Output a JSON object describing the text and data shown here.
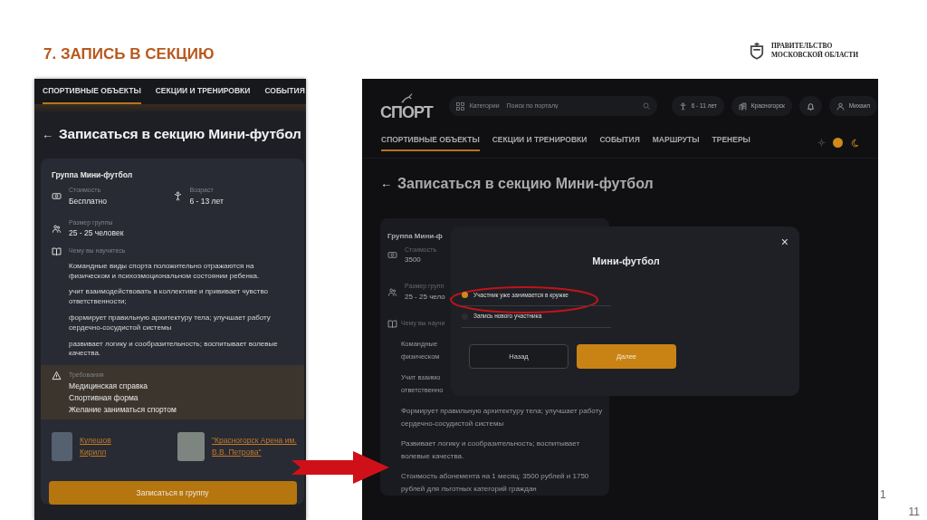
{
  "slide": {
    "title": "7. ЗАПИСЬ В СЕКЦИЮ",
    "logo_lines": [
      "ПРАВИТЕЛЬСТВО",
      "МОСКОВСКОЙ ОБЛАСТИ"
    ],
    "page_number_fragment": "1",
    "page_number": "11"
  },
  "mobile_screen": {
    "nav": [
      {
        "label": "СПОРТИВНЫЕ ОБЪЕКТЫ",
        "selected": true
      },
      {
        "label": "СЕКЦИИ И ТРЕНИРОВКИ",
        "selected": false
      },
      {
        "label": "СОБЫТИЯ",
        "selected": false
      }
    ],
    "back": "←",
    "heading": "Записаться в секцию Мини-футбол",
    "group_title": "Группа Мини-футбол",
    "info": [
      {
        "kind": "cost",
        "label": "Стоимость",
        "value": "Бесплатно"
      },
      {
        "kind": "age",
        "label": "Возраст",
        "value": "6 - 13 лет"
      },
      {
        "kind": "group",
        "label": "Размер группы",
        "value": "25 - 25 человек"
      }
    ],
    "learn_label": "Чему вы научитесь",
    "paragraphs": [
      "Командные виды спорта положительно отражаются на физическом и психоэмоциональном состоянии ребенка.",
      "учит взаимодействовать в коллективе и прививает чувство ответственности;",
      "формирует правильную архитектуру тела; улучшает работу сердечно-сосудистой системы",
      "развивает логику и сообразительность; воспитывает волевые качества."
    ],
    "requirements": {
      "label": "Требования",
      "items": [
        "Медицинская справка",
        "Спортивная форма",
        "Желание заниматься спортом"
      ]
    },
    "coach": "Кулешов Кирилл",
    "venue": "\"Красногорск Арена им. В.В. Петрова\"",
    "button": "Записаться в группу"
  },
  "desktop_screen": {
    "logo": "СПОРТ",
    "categories": "Категории",
    "search": {
      "placeholder": "Поиск по порталу"
    },
    "age_chip": "6 - 11 лет",
    "city_chip": "Красногорск",
    "user": "Михаил",
    "nav": [
      {
        "label": "СПОРТИВНЫЕ ОБЪЕКТЫ",
        "selected": true
      },
      {
        "label": "СЕКЦИИ И ТРЕНИРОВКИ",
        "selected": false
      },
      {
        "label": "СОБЫТИЯ",
        "selected": false
      },
      {
        "label": "МАРШРУТЫ",
        "selected": false
      },
      {
        "label": "ТРЕНЕРЫ",
        "selected": false
      }
    ],
    "dark_theme": true,
    "back": "←",
    "heading": "Записаться в секцию Мини-футбол",
    "card": {
      "group_title": "Группа Мини-ф",
      "info": [
        {
          "kind": "cost",
          "label": "Стоимость",
          "value": "3500"
        },
        {
          "kind": "group",
          "label": "Размер групп",
          "value": "25 - 25 чело"
        }
      ],
      "learn_label": "Чему вы научи",
      "partial_paragraphs": [
        [
          "Командные",
          "физическом"
        ],
        [
          "Учит взаимо",
          "ответственно"
        ]
      ],
      "paragraphs": [
        "Формирует правильную архитектуру тела; улучшает работу сердечно-сосудистой системы",
        "Развивает логику и сообразительность; воспитывает волевые качества.",
        "Стоимость абонемента на 1 месяц: 3500 рублей и 1750 рублей для льготных категорий граждан"
      ]
    },
    "modal": {
      "close": "×",
      "title": "Мини-футбол",
      "options": [
        {
          "label": "Участник уже занимается в кружке",
          "selected": true
        },
        {
          "label": "Запись нового участника",
          "selected": false
        }
      ],
      "buttons": [
        {
          "label": "Назад",
          "kind": "secondary"
        },
        {
          "label": "Далее",
          "kind": "primary"
        }
      ]
    }
  }
}
